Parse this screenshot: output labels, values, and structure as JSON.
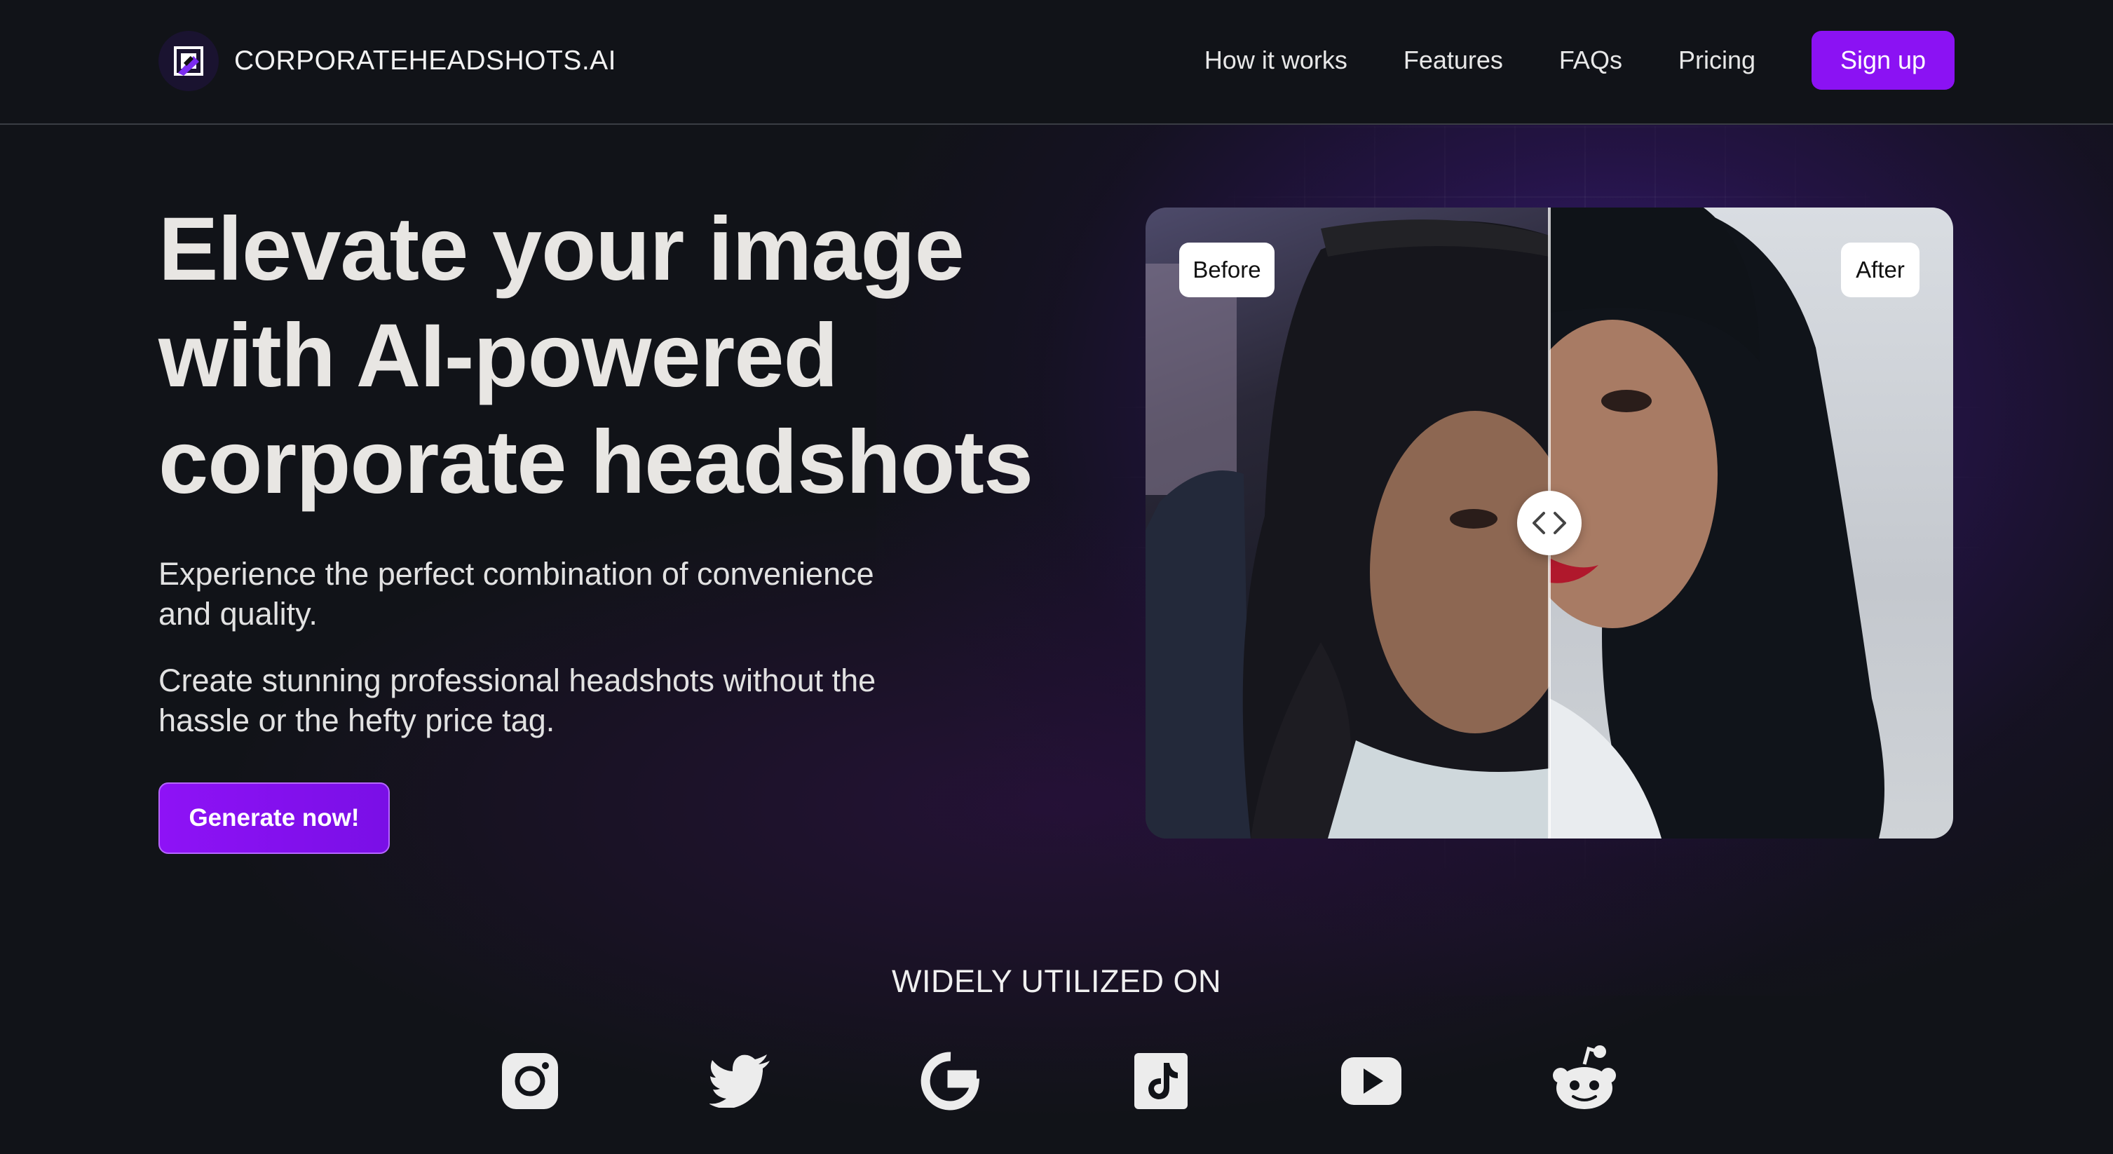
{
  "header": {
    "brand": "CORPORATEHEADSHOTS.AI",
    "nav": [
      {
        "label": "How it works"
      },
      {
        "label": "Features"
      },
      {
        "label": "FAQs"
      },
      {
        "label": "Pricing"
      }
    ],
    "signup_label": "Sign up"
  },
  "hero": {
    "title_lines": [
      "Elevate your image",
      "with AI-powered",
      "corporate headshots"
    ],
    "subtitle_1": "Experience the perfect combination of convenience and quality.",
    "subtitle_2": "Create stunning professional headshots without the hassle or the hefty price tag.",
    "cta_label": "Generate now!"
  },
  "compare": {
    "before_label": "Before",
    "after_label": "After",
    "handle_icon": "chevron-left-right-icon"
  },
  "usage": {
    "heading": "WIDELY UTILIZED ON",
    "platforms": [
      "instagram",
      "twitter",
      "google",
      "tiktok",
      "youtube",
      "reddit"
    ]
  },
  "colors": {
    "accent": "#8b12f3",
    "background": "#111318",
    "text": "#e8e6e3"
  }
}
